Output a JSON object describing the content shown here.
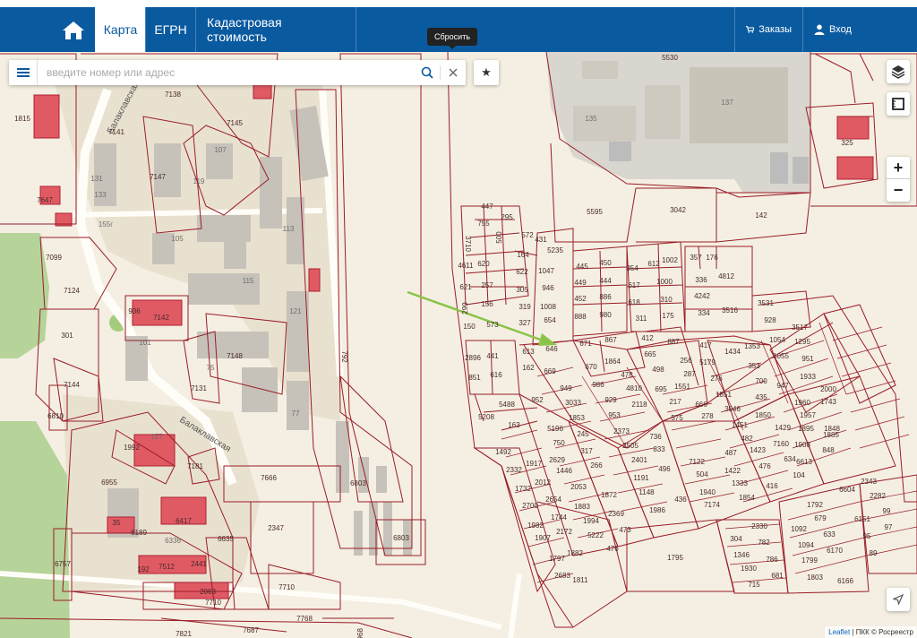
{
  "header": {
    "nav": [
      "Карта",
      "ЕГРН",
      "Кадастровая стоимость"
    ],
    "orders_label": "Заказы",
    "login_label": "Вход"
  },
  "search": {
    "placeholder": "введите номер или адрес",
    "reset_tooltip": "Сбросить"
  },
  "zoom": {
    "in": "+",
    "out": "−"
  },
  "attribution": {
    "link": "Leaflet",
    "text": " | ПКК © Росреестр"
  },
  "map": {
    "streets": [
      "Балаклавская",
      "Балаклавская"
    ],
    "parcels": [
      "7138",
      "7145",
      "7141",
      "7147",
      "1815",
      "7647",
      "7099",
      "7124",
      "301",
      "7144",
      "6810",
      "936",
      "7142",
      "7148",
      "7131",
      "1992",
      "7181",
      "6955",
      "7666",
      "6803",
      "6803",
      "2347",
      "6635",
      "35",
      "6189",
      "6417",
      "6757",
      "192",
      "7512",
      "2441",
      "2063",
      "7710",
      "7710",
      "7768",
      "7821",
      "7687",
      "6968",
      "792",
      "5530",
      "5595",
      "3042",
      "142",
      "325",
      "447",
      "295",
      "755",
      "500",
      "3710",
      "4611",
      "620",
      "621",
      "257",
      "299",
      "156",
      "150",
      "573",
      "572",
      "431",
      "164",
      "5235",
      "622",
      "1047",
      "305",
      "946",
      "319",
      "1008",
      "327",
      "654",
      "445",
      "450",
      "449",
      "444",
      "452",
      "886",
      "888",
      "980",
      "354",
      "612",
      "1002",
      "617",
      "1000",
      "618",
      "310",
      "311",
      "175",
      "357",
      "176",
      "336",
      "4812",
      "4242",
      "334",
      "3516",
      "3531",
      "928",
      "3517",
      "1054",
      "1295",
      "1055",
      "951",
      "947",
      "1933",
      "1960",
      "2000",
      "1957",
      "1743",
      "1895",
      "1848",
      "1908",
      "1885",
      "6613",
      "848",
      "2896",
      "441",
      "851",
      "616",
      "613",
      "646",
      "162",
      "669",
      "671",
      "867",
      "670",
      "1864",
      "412",
      "887",
      "665",
      "256",
      "498",
      "287",
      "695",
      "1551",
      "217",
      "575",
      "666",
      "278",
      "417",
      "5179",
      "1434",
      "1353",
      "276",
      "353",
      "1851",
      "700",
      "3046",
      "435",
      "1451",
      "1850",
      "482",
      "1429",
      "1423",
      "7160",
      "476",
      "634",
      "416",
      "104",
      "5208",
      "5488",
      "163",
      "952",
      "949",
      "5196",
      "3033",
      "750",
      "1853",
      "2629",
      "245",
      "1446",
      "317",
      "2053",
      "266",
      "1883",
      "1872",
      "1994",
      "2369",
      "5222",
      "473",
      "476",
      "986",
      "478",
      "929",
      "4810",
      "953",
      "2118",
      "2373",
      "736",
      "2505",
      "833",
      "2401",
      "496",
      "1191",
      "1148",
      "1986",
      "436",
      "7122",
      "487",
      "504",
      "1422",
      "1940",
      "1333",
      "7174",
      "1854",
      "1492",
      "2332",
      "1917",
      "1732",
      "2012",
      "2700",
      "2654",
      "1982",
      "1744",
      "1907",
      "2172",
      "1797",
      "1882",
      "2683",
      "1811",
      "1795",
      "304",
      "2330",
      "1346",
      "782",
      "1930",
      "786",
      "715",
      "681",
      "1092",
      "679",
      "1094",
      "633",
      "1799",
      "6170",
      "1803",
      "6166",
      "1792",
      "6604",
      "2343",
      "2282",
      "6151",
      "99",
      "95",
      "97",
      "89",
      "105",
      "107",
      "119",
      "113",
      "115",
      "121",
      "101",
      "75",
      "77",
      "157",
      "155г",
      "131",
      "133",
      "137",
      "135",
      "6336"
    ]
  }
}
